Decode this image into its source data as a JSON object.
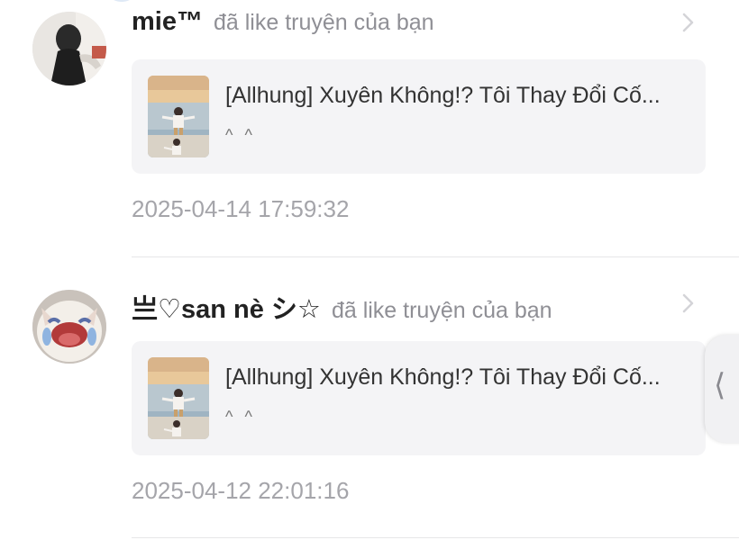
{
  "notifications": [
    {
      "username": "mie™",
      "action": "đã like truyện của bạn",
      "story_title": "[Allhung] Xuyên Không!? Tôi Thay Đổi Cố...",
      "story_sub": "^ ^",
      "timestamp": "2025-04-14 17:59:32"
    },
    {
      "username": "亗♡san nè シ☆",
      "action": "đã like truyện của bạn",
      "story_title": "[Allhung] Xuyên Không!? Tôi Thay Đổi Cố...",
      "story_sub": "^ ^",
      "timestamp": "2025-04-12 22:01:16"
    }
  ],
  "icons": {
    "chevron": "chevron-right-icon",
    "side_handle": "chevron-left-icon"
  },
  "colors": {
    "card_bg": "#f4f4f6",
    "muted_text": "#8f8f95",
    "timestamp": "#a5a5aa"
  }
}
